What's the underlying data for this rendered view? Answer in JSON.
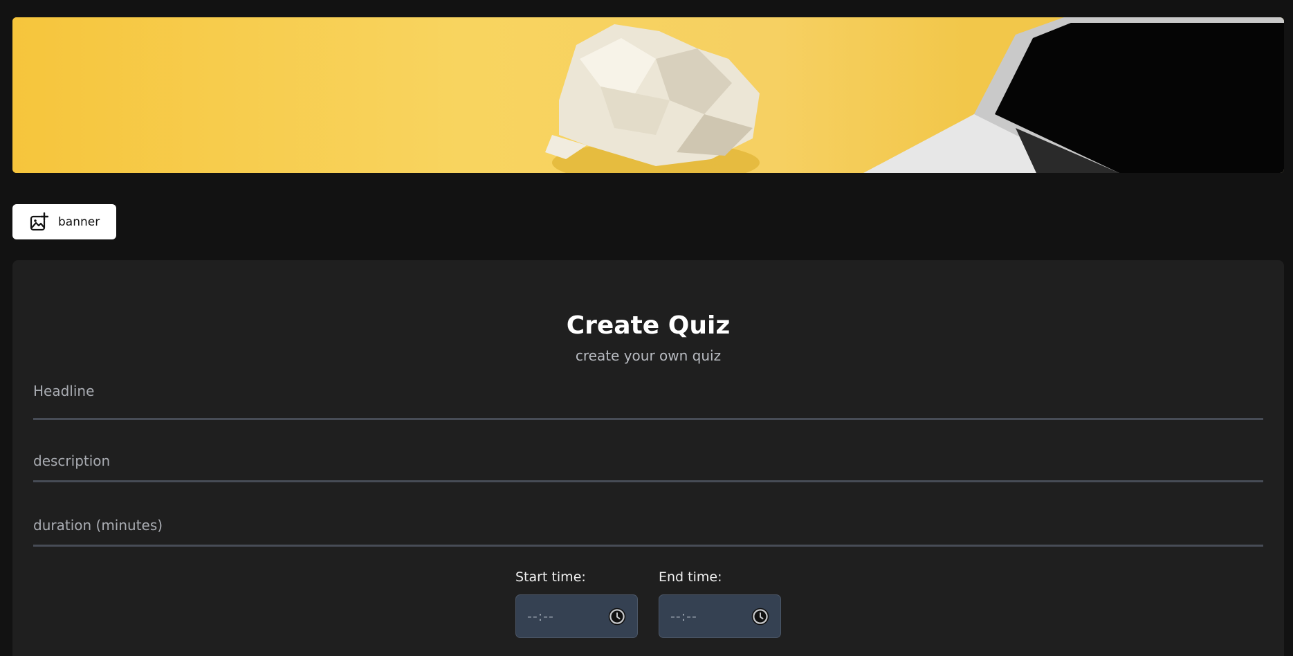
{
  "banner_image": {
    "description_icon": "crumpled-paper-and-laptop-photo",
    "accent": "#f6c53e"
  },
  "banner_button": {
    "label": "banner",
    "icon": "image-add-icon"
  },
  "form": {
    "title": "Create Quiz",
    "subtitle": "create your own quiz",
    "headline_placeholder": "Headline",
    "description_placeholder": "description",
    "duration_placeholder": "duration (minutes)",
    "start_time_label": "Start time:",
    "start_time_value": "--:--",
    "end_time_label": "End time:",
    "end_time_value": "--:--"
  },
  "colors": {
    "background": "#121212",
    "card": "#1f1f1f",
    "input_underline": "#474c56",
    "time_box": "#354152"
  }
}
